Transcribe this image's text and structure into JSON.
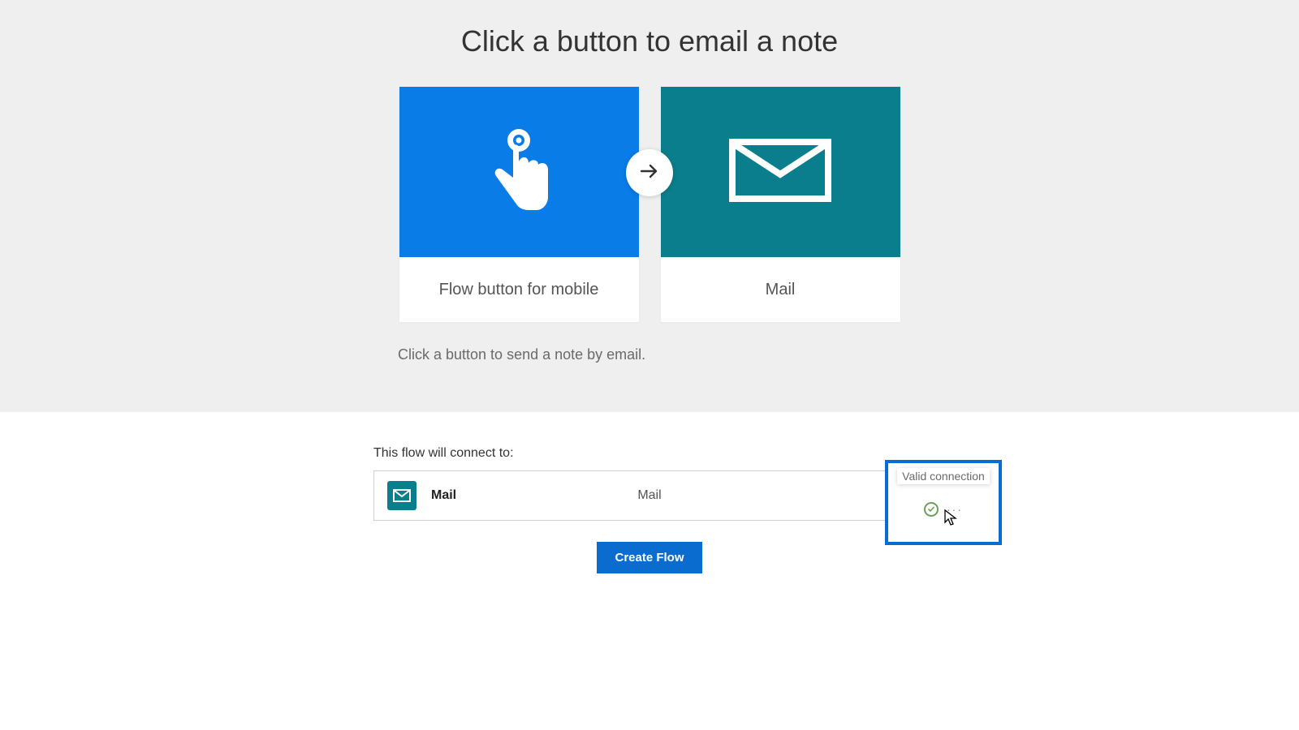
{
  "hero": {
    "title": "Click a button to email a note",
    "description": "Click a button to send a note by email.",
    "tiles": [
      {
        "label": "Flow button for mobile"
      },
      {
        "label": "Mail"
      }
    ]
  },
  "connections": {
    "heading": "This flow will connect to:",
    "items": [
      {
        "name": "Mail",
        "type": "Mail"
      }
    ],
    "tooltip": "Valid connection"
  },
  "actions": {
    "create_label": "Create Flow"
  }
}
